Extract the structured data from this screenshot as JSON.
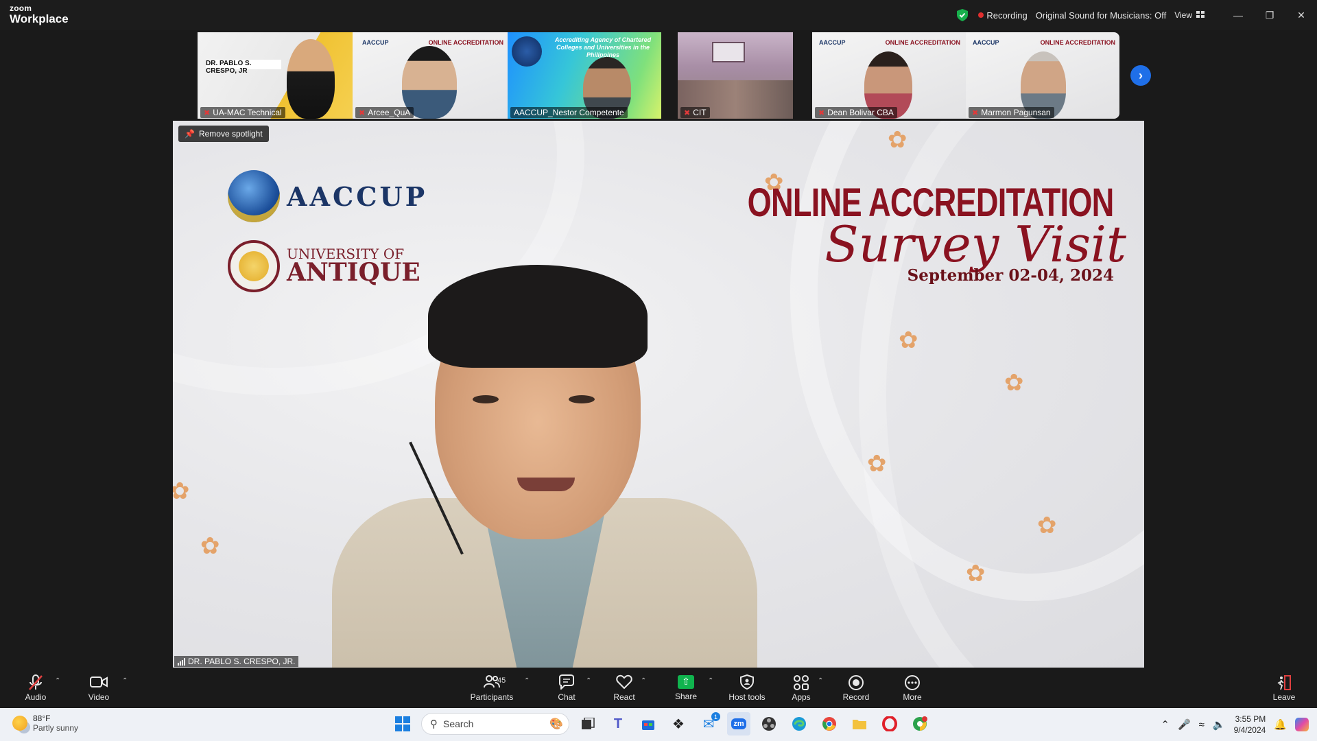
{
  "app": {
    "brand_top": "zoom",
    "brand_bottom": "Workplace"
  },
  "titlebar": {
    "recording_label": "Recording",
    "sound_label": "Original Sound for Musicians: Off",
    "view_label": "View"
  },
  "thumbnails": [
    {
      "name": "UA-MAC Technical"
    },
    {
      "name": "Arcee_QuA"
    },
    {
      "name": "AACCUP_Nestor Competente"
    },
    {
      "name": "CIT"
    },
    {
      "name": "Dean Bolivar CBA"
    },
    {
      "name": "Marmon Pagunsan"
    }
  ],
  "thumb_texts": {
    "crespo_name": "DR. PABLO S. CRESPO, JR",
    "oa_small": "ONLINE ACCREDITATION",
    "aaccup_small": "AACCUP",
    "aaccup_agency": "Accrediting Agency of Chartered Colleges and Universities in the Philippines"
  },
  "main_video": {
    "spotlight_button": "Remove spotlight",
    "speaker_name": "DR. PABLO S. CRESPO, JR.",
    "background": {
      "aaccup": "AACCUP",
      "university_line1": "UNIVERSITY OF",
      "university_line2": "ANTIQUE",
      "title": "ONLINE ACCREDITATION",
      "subtitle": "Survey Visit",
      "date": "September 02-04, 2024"
    }
  },
  "toolbar": {
    "audio": "Audio",
    "video": "Video",
    "participants": "Participants",
    "participants_count": "45",
    "chat": "Chat",
    "react": "React",
    "share": "Share",
    "host_tools": "Host tools",
    "apps": "Apps",
    "record": "Record",
    "more": "More",
    "leave": "Leave"
  },
  "taskbar": {
    "temperature": "88°F",
    "condition": "Partly sunny",
    "search_placeholder": "Search",
    "time": "3:55 PM",
    "date": "9/4/2024",
    "mail_badge": "1"
  },
  "colors": {
    "accent": "#1f6fe8",
    "record": "#e02e2e",
    "share": "#10b44e",
    "banner": "#8a1220"
  }
}
